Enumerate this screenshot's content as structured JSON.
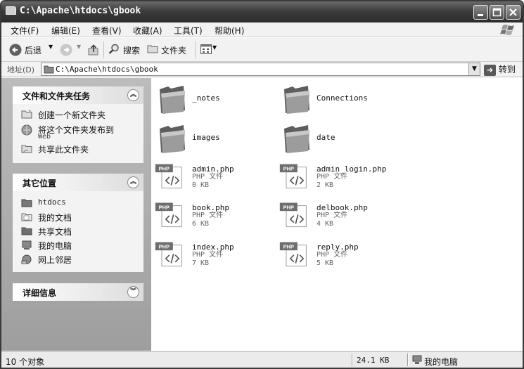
{
  "window": {
    "title": "C:\\Apache\\htdocs\\gbook",
    "icon": "folder-icon",
    "controls": [
      "minimize-icon",
      "maximize-icon",
      "close-icon"
    ]
  },
  "menu": {
    "file": "文件(F)",
    "edit": "编辑(E)",
    "view": "查看(V)",
    "favorites": "收藏(A)",
    "tools": "工具(T)",
    "help": "帮助(H)"
  },
  "toolbar": {
    "back": "后退",
    "search": "搜索",
    "folders": "文件夹"
  },
  "address": {
    "label": "地址(D)",
    "path": "C:\\Apache\\htdocs\\gbook",
    "go": "转到"
  },
  "tasks": {
    "title": "文件和文件夹任务",
    "items": [
      {
        "label": "创建一个新文件夹",
        "icon": "new-folder-icon"
      },
      {
        "label": "将这个文件夹发布到",
        "label2": "Web",
        "icon": "publish-web-icon"
      },
      {
        "label": "共享此文件夹",
        "icon": "share-folder-icon"
      }
    ]
  },
  "places": {
    "title": "其它位置",
    "items": [
      {
        "label": "htdocs",
        "icon": "folder-icon"
      },
      {
        "label": "我的文档",
        "icon": "documents-icon"
      },
      {
        "label": "共享文档",
        "icon": "shared-docs-icon"
      },
      {
        "label": "我的电脑",
        "icon": "computer-icon"
      },
      {
        "label": "网上邻居",
        "icon": "network-icon"
      }
    ]
  },
  "details": {
    "title": "详细信息"
  },
  "files": [
    {
      "name": "_notes",
      "kind": "folder"
    },
    {
      "name": "Connections",
      "kind": "folder"
    },
    {
      "name": "images",
      "kind": "folder"
    },
    {
      "name": "date",
      "kind": "folder"
    },
    {
      "name": "admin.php",
      "type": "PHP 文件",
      "size": "0 KB",
      "kind": "php",
      "badge": "PHP"
    },
    {
      "name": "admin_login.php",
      "type": "PHP 文件",
      "size": "2 KB",
      "kind": "php",
      "badge": "PHP"
    },
    {
      "name": "book.php",
      "type": "PHP 文件",
      "size": "6 KB",
      "kind": "php",
      "badge": "PHP"
    },
    {
      "name": "delbook.php",
      "type": "PHP 文件",
      "size": "4 KB",
      "kind": "php",
      "badge": "PHP"
    },
    {
      "name": "index.php",
      "type": "PHP 文件",
      "size": "7 KB",
      "kind": "php",
      "badge": "PHP"
    },
    {
      "name": "reply.php",
      "type": "PHP 文件",
      "size": "5 KB",
      "kind": "php",
      "badge": "PHP"
    }
  ],
  "status": {
    "count": "10 个对象",
    "size": "24.1 KB",
    "location": "我的电脑"
  }
}
